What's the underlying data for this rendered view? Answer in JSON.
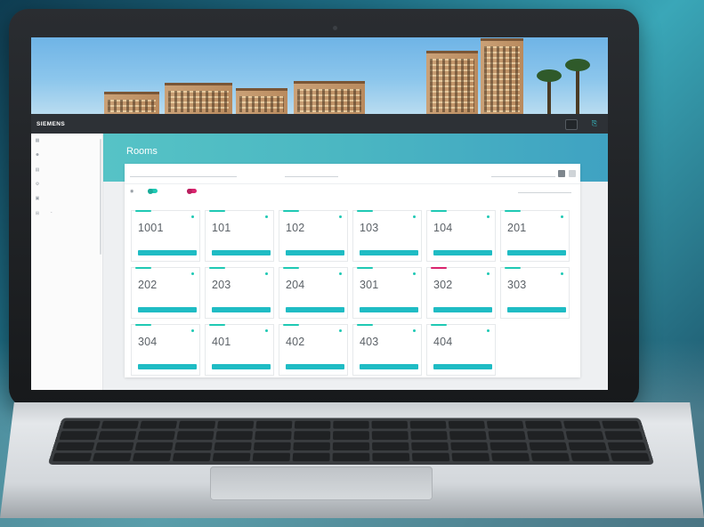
{
  "app": {
    "logo": "SIEMENS",
    "logo_sub": "",
    "building_button": "",
    "page_title": "Rooms"
  },
  "sidebar": {
    "items": [
      {
        "label": "",
        "icon": "dashboard-icon"
      },
      {
        "label": "",
        "icon": "person-icon"
      },
      {
        "label": "",
        "icon": "calendar-icon"
      },
      {
        "label": "",
        "icon": "gear-icon"
      },
      {
        "label": "",
        "icon": "building-icon"
      },
      {
        "label": "",
        "icon": "grid-icon",
        "expanded": true
      }
    ],
    "sub_items": [
      "",
      "",
      "",
      "",
      "",
      "",
      "",
      "",
      "",
      "",
      "",
      ""
    ]
  },
  "toolbar": {
    "filter_text": "",
    "floor_selector": "",
    "sort_label": "",
    "search_value": ""
  },
  "legend": {
    "item1": "",
    "item2": "",
    "sort_label": "",
    "colors": {
      "occupied": "#1fc9b4",
      "alert": "#d9246e"
    }
  },
  "rooms": [
    {
      "number": "1001",
      "status_color": "#1fc9b4"
    },
    {
      "number": "101",
      "status_color": "#1fc9b4"
    },
    {
      "number": "102",
      "status_color": "#1fc9b4"
    },
    {
      "number": "103",
      "status_color": "#1fc9b4"
    },
    {
      "number": "104",
      "status_color": "#1fc9b4"
    },
    {
      "number": "201",
      "status_color": "#1fc9b4"
    },
    {
      "number": "202",
      "status_color": "#1fc9b4"
    },
    {
      "number": "203",
      "status_color": "#1fc9b4"
    },
    {
      "number": "204",
      "status_color": "#1fc9b4"
    },
    {
      "number": "301",
      "status_color": "#1fc9b4"
    },
    {
      "number": "302",
      "status_color": "#d9246e"
    },
    {
      "number": "303",
      "status_color": "#1fc9b4"
    },
    {
      "number": "304",
      "status_color": "#1fc9b4"
    },
    {
      "number": "401",
      "status_color": "#1fc9b4"
    },
    {
      "number": "402",
      "status_color": "#1fc9b4"
    },
    {
      "number": "403",
      "status_color": "#1fc9b4"
    },
    {
      "number": "404",
      "status_color": "#1fc9b4"
    }
  ],
  "colors": {
    "accent": "#1fbcc4",
    "header": "#2d3136",
    "banner": "#4ab6c2"
  }
}
